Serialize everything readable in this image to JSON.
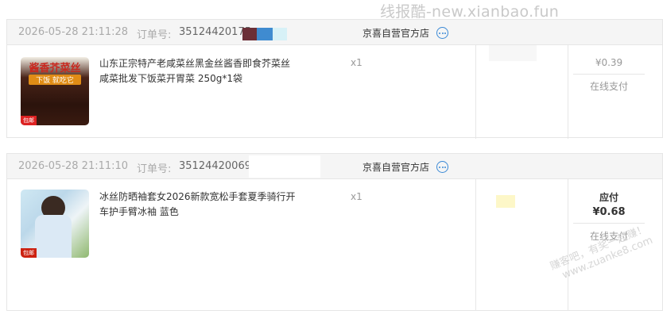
{
  "watermark": {
    "top": "线报酷-new.xianbao.fun",
    "diag_line1": "赚客吧，有奖一起赚！",
    "diag_line2": "www.zuanke8.com"
  },
  "orders": [
    {
      "time": "2026-05-28 21:11:28",
      "order_no_label": "订单号:",
      "order_no": "35124420175",
      "shop": "京喜自营官方店",
      "product_name": "山东正宗特产老咸菜丝黑金丝酱香即食芥菜丝咸菜批发下饭菜开胃菜 250g*1袋",
      "thumb_text_top": "酱香芥菜丝",
      "thumb_text_mid": "下饭 就吃它",
      "thumb_badge": "包邮",
      "qty": "x1",
      "price": "¥0.39",
      "pay_method": "在线支付"
    },
    {
      "time": "2026-05-28 21:11:10",
      "order_no_label": "订单号:",
      "order_no": "35124420069",
      "shop": "京喜自营官方店",
      "product_name": "冰丝防晒袖套女2026新款宽松手套夏季骑行开车护手臂冰袖 蓝色",
      "thumb_badge": "包邮",
      "qty": "x1",
      "due_label": "应付",
      "price": "¥0.68",
      "pay_method": "在线支付"
    }
  ]
}
